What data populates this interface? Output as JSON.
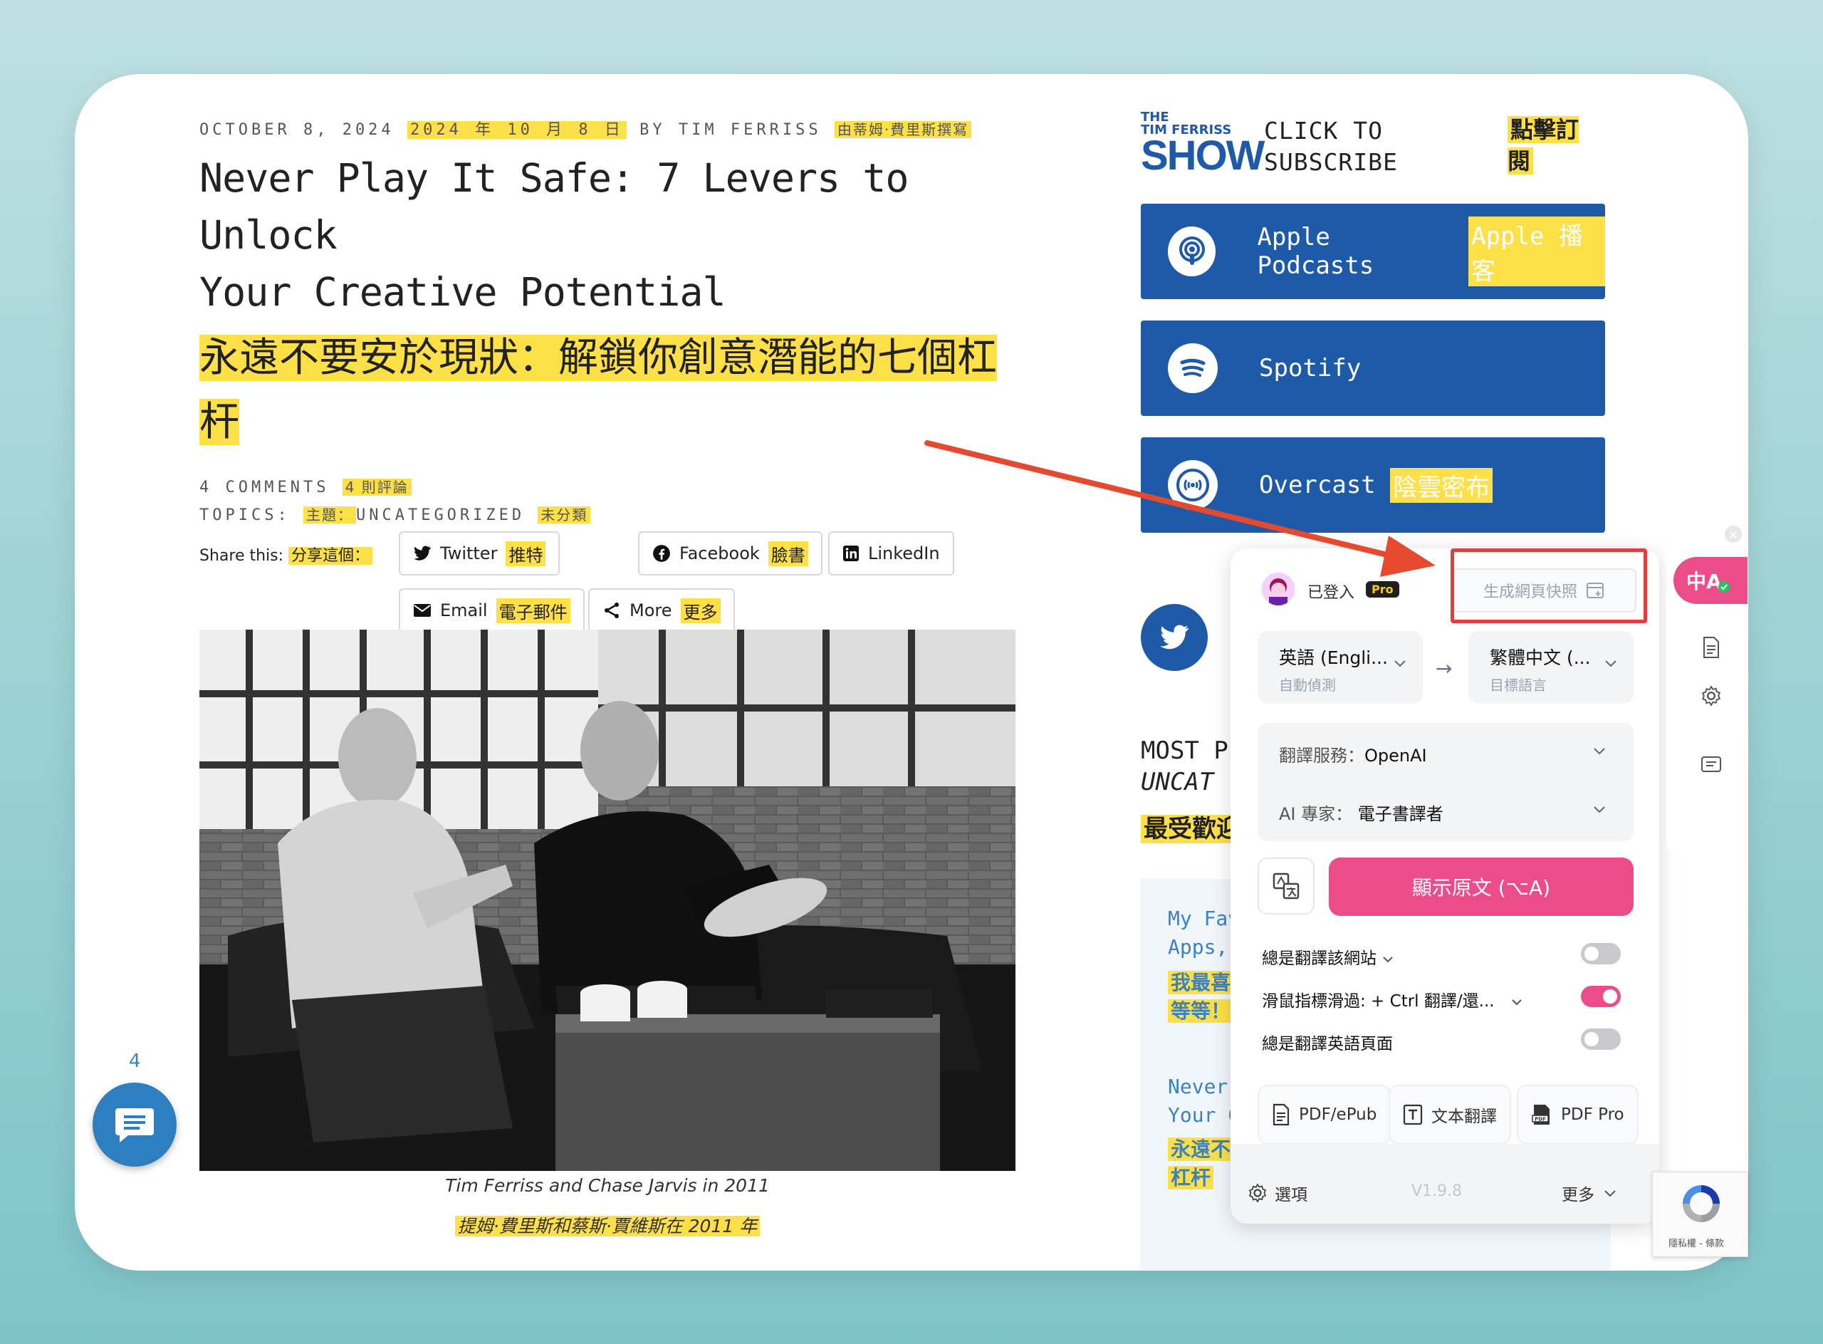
{
  "article": {
    "meta_date": "OCTOBER 8, 2024",
    "meta_date_zh": "2024 年 10 月 8 日",
    "meta_by": "BY TIM FERRISS",
    "meta_by_zh": "由蒂姆·費里斯撰寫",
    "title_en_line1": "Never Play It Safe: 7 Levers to Unlock",
    "title_en_line2": "Your Creative Potential",
    "title_zh": "永遠不要安於現狀：解鎖你創意潛能的七個杠杆",
    "comments": "4 COMMENTS",
    "comments_zh": "4 則評論",
    "topics_label": "TOPICS:",
    "topics_zh": "主題：",
    "topics_value": "UNCATEGORIZED",
    "topics_value_zh": "未分類",
    "share_label": "Share this:",
    "share_label_zh": "分享這個：",
    "share_buttons": [
      {
        "label": "Twitter",
        "zh": "推特"
      },
      {
        "label": "Facebook",
        "zh": "臉書"
      },
      {
        "label": "LinkedIn",
        "zh": ""
      },
      {
        "label": "Email",
        "zh": "電子郵件"
      },
      {
        "label": "More",
        "zh": "更多"
      }
    ],
    "caption": "Tim Ferriss and Chase Jarvis in 2011",
    "caption_zh": "提姆·費里斯和蔡斯·賈維斯在 2011 年"
  },
  "sidebar": {
    "logo_the": "THE",
    "logo_name": "TIM FERRISS",
    "logo_show": "SHOW",
    "click_line1": "CLICK TO",
    "click_line2": "SUBSCRIBE",
    "click_zh": "點擊訂閱",
    "podcasts": [
      {
        "label": "Apple Podcasts",
        "zh": "Apple 播客"
      },
      {
        "label": "Spotify",
        "zh": ""
      },
      {
        "label": "Overcast",
        "zh": "陰雲密布"
      }
    ],
    "most_line1": "MOST P",
    "most_line2": "UNCAT",
    "most_zh": "最受歡迎",
    "list": [
      {
        "line1": "My Fav",
        "line2": "Apps,",
        "zh1": "我最喜",
        "zh2": "等等！"
      },
      {
        "line1": "Never",
        "line2": "Your C",
        "zh1": "永遠不",
        "zh2": "杠杆"
      }
    ]
  },
  "comment_count": "4",
  "translator": {
    "logged_in": "已登入",
    "pro_badge": "Pro",
    "snapshot": "生成網頁快照",
    "source_lang": "英語 (Engli...",
    "source_sub": "自動偵測",
    "swap_arrow": "→",
    "target_lang": "繁體中文 (...",
    "target_sub": "目標語言",
    "service_label": "翻譯服務：",
    "service_value": "OpenAI",
    "expert_label": "AI 專家：",
    "expert_value": "電子書譯者",
    "show_original": "顯示原文 (⌥A)",
    "options": [
      {
        "label": "總是翻譯該網站",
        "on": false
      },
      {
        "label": "滑鼠指標滑過: + Ctrl 翻譯/還...",
        "on": true
      },
      {
        "label": "總是翻譯英語頁面",
        "on": false
      }
    ],
    "tools": [
      {
        "label": "PDF/ePub"
      },
      {
        "label": "文本翻譯"
      },
      {
        "label": "PDF Pro"
      }
    ],
    "footer_options": "選項",
    "version": "V1.9.8",
    "footer_more": "更多",
    "float_tab": "中A",
    "recaptcha_text": "隱私權 - 條款"
  },
  "colors": {
    "brand_blue": "#1e5aa8",
    "highlight": "#fde047",
    "accent_pink": "#ec4d8a",
    "annotation_red": "#e43d3d"
  }
}
